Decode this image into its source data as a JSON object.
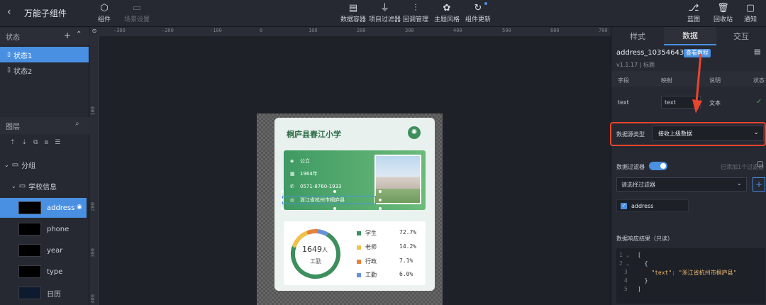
{
  "app": {
    "title": "万能子组件"
  },
  "toolbar": {
    "left": [
      {
        "label": "组件",
        "icon": "component-icon",
        "disabled": false
      },
      {
        "label": "场景设置",
        "icon": "scene-settings-icon",
        "disabled": true
      }
    ],
    "center": [
      {
        "label": "数据容器",
        "icon": "data-container-icon"
      },
      {
        "label": "项目过滤器",
        "icon": "filter-icon"
      },
      {
        "label": "回调管理",
        "icon": "callback-icon"
      },
      {
        "label": "主题风格",
        "icon": "theme-icon"
      },
      {
        "label": "组件更新",
        "icon": "update-icon"
      }
    ],
    "right": [
      {
        "label": "蓝图",
        "icon": "blueprint-icon"
      },
      {
        "label": "回收站",
        "icon": "trash-icon"
      },
      {
        "label": "通知",
        "icon": "message-icon"
      }
    ]
  },
  "states": {
    "header": "状态",
    "items": [
      "状态1",
      "状态2"
    ],
    "active_index": 0
  },
  "layers": {
    "header": "图层",
    "groups": [
      {
        "label": "分组"
      },
      {
        "label": "学校信息"
      }
    ],
    "items": [
      {
        "label": "address",
        "active": true
      },
      {
        "label": "phone",
        "active": false
      },
      {
        "label": "year",
        "active": false
      },
      {
        "label": "type",
        "active": false
      },
      {
        "label": "日历",
        "active": false
      }
    ]
  },
  "rulers": {
    "h": [
      "-300",
      "-200",
      "-100",
      "0",
      "100",
      "200",
      "300",
      "400",
      "500",
      "600",
      "700"
    ],
    "v": [
      "100",
      "200",
      "300",
      "400"
    ]
  },
  "card": {
    "school": "桐庐县春江小学",
    "info": [
      {
        "icon": "layers-icon",
        "text": "公立"
      },
      {
        "icon": "calendar-icon",
        "text": "1964年"
      },
      {
        "icon": "phone-icon",
        "text": "0571-8760-1933"
      },
      {
        "icon": "location-icon",
        "text": "浙江省杭州市桐庐县"
      }
    ],
    "total": "1649",
    "total_unit": "人",
    "total_label": "工勤",
    "legend": [
      {
        "label": "学生",
        "value": "72.7%",
        "color": "#3d8f5e"
      },
      {
        "label": "老师",
        "value": "14.2%",
        "color": "#f0c14b"
      },
      {
        "label": "行政",
        "value": "7.1%",
        "color": "#e8823a"
      },
      {
        "label": "工勤",
        "value": "6.0%",
        "color": "#6a92d6"
      }
    ]
  },
  "right_panel": {
    "tabs": [
      "样式",
      "数据",
      "交互"
    ],
    "active_tab": 1,
    "component_id": "address_103546438",
    "tutorial_btn": "查看教程",
    "version": "v1.1.17 | 标题",
    "table": {
      "headers": [
        "字段",
        "映射",
        "说明",
        "状态"
      ],
      "row": {
        "field": "text",
        "mapping": "text",
        "desc": "文本"
      }
    },
    "source_type": {
      "label": "数据源类型",
      "value": "接收上级数据"
    },
    "filter": {
      "label": "数据过滤器",
      "added": "已添加1个过滤器",
      "placeholder": "请选择过滤器",
      "checked_item": "address"
    },
    "result": {
      "label": "数据响应结果（只读）",
      "lines": [
        "[",
        "  {",
        "    \"text\": \"浙江省杭州市桐庐县\"",
        "  }",
        "]"
      ]
    }
  },
  "colors": {
    "accent": "#4a90e2",
    "highlight": "#e8452c",
    "toggle": "#4a90e2"
  }
}
